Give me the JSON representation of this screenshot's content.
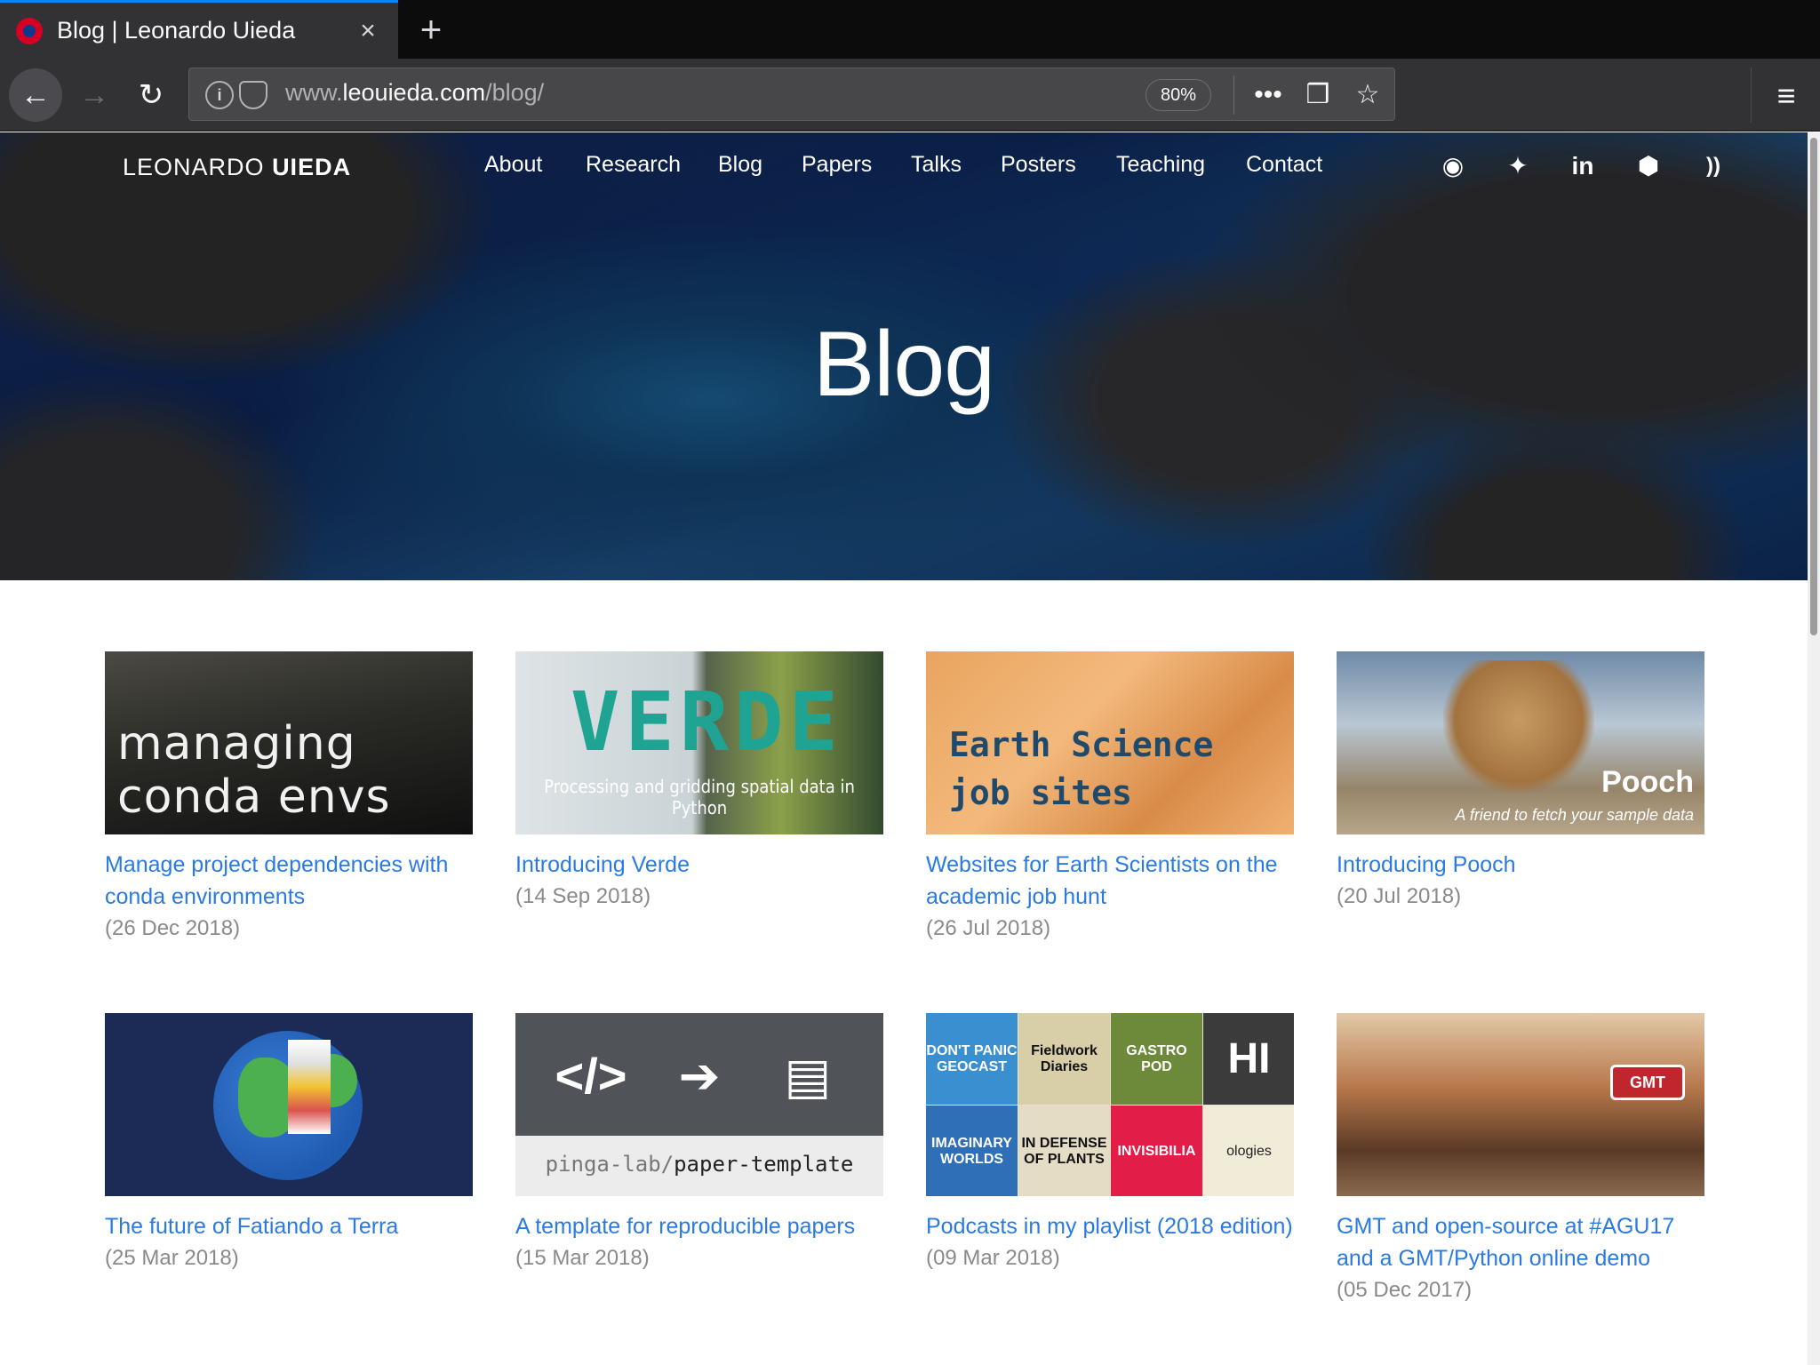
{
  "browser": {
    "tab_title": "Blog | Leonardo Uieda",
    "tab_close_icon": "×",
    "new_tab_icon": "+",
    "url_prefix": "www.",
    "url_host": "leouieda.com",
    "url_path": "/blog/",
    "zoom": "80%",
    "actions": [
      "•••",
      "❒",
      "☆"
    ],
    "menu_icon": "≡"
  },
  "site": {
    "brand_first": "LEONARDO",
    "brand_second": "UIEDA",
    "nav": [
      "About",
      "Research",
      "Blog",
      "Papers",
      "Talks",
      "Posters",
      "Teaching",
      "Contact"
    ],
    "social_icons": [
      "github-icon",
      "twitter-icon",
      "linkedin-icon",
      "tags-icon",
      "rss-icon"
    ],
    "social_glyphs": [
      "◉",
      "✦",
      "in",
      "⬢",
      "))"
    ],
    "hero_title": "Blog"
  },
  "thumbs": {
    "conda_lines": [
      "managing",
      "conda envs"
    ],
    "verde_title": "VERDE",
    "verde_sub": "Processing and gridding spatial data in Python",
    "earth_lines": [
      "Earth Science",
      "job sites"
    ],
    "pooch_title": "Pooch",
    "pooch_sub": "A friend to fetch your sample data",
    "template_icons": [
      "</>",
      "➔",
      "▤"
    ],
    "template_repo_prefix": "pinga-lab/",
    "template_repo_name": "paper-template",
    "podcast_tiles": [
      "DON'T PANIC GEOCAST",
      "Fieldwork Diaries",
      "GASTRO POD",
      "HI",
      "IMAGINARY WORLDS",
      "IN DEFENSE OF PLANTS",
      "INVISIBILIA",
      "ologies"
    ],
    "gmt_sign": "GMT"
  },
  "posts": [
    {
      "title": "Manage project dependencies with conda environments",
      "date": "(26 Dec 2018)"
    },
    {
      "title": "Introducing Verde",
      "date": "(14 Sep 2018)"
    },
    {
      "title": "Websites for Earth Scientists on the academic job hunt",
      "date": "(26 Jul 2018)"
    },
    {
      "title": "Introducing Pooch",
      "date": "(20 Jul 2018)"
    },
    {
      "title": "The future of Fatiando a Terra",
      "date": "(25 Mar 2018)"
    },
    {
      "title": "A template for reproducible papers",
      "date": "(15 Mar 2018)"
    },
    {
      "title": "Podcasts in my playlist (2018 edition)",
      "date": "(09 Mar 2018)"
    },
    {
      "title": "GMT and open-source at #AGU17 and a GMT/Python online demo",
      "date": "(05 Dec 2017)"
    }
  ],
  "colors": {
    "link": "#2a7ae2",
    "date": "#8a8a8a",
    "chrome_dark": "#0c0c0d",
    "chrome_toolbar": "#323234",
    "tab_accent": "#0a84ff"
  }
}
